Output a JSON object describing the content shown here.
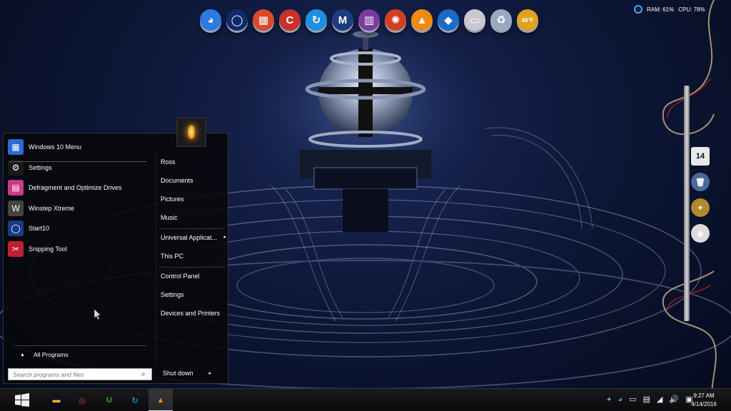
{
  "top_dock": {
    "icons": [
      {
        "name": "browser-globe-icon",
        "glyph": "◕",
        "color": "#2d7be0"
      },
      {
        "name": "start10-ring-icon",
        "glyph": "◯",
        "color": "#0e2a6a"
      },
      {
        "name": "file-manager-icon",
        "glyph": "▦",
        "color": "#d84a2a"
      },
      {
        "name": "ccleaner-icon",
        "glyph": "C",
        "color": "#c8302a"
      },
      {
        "name": "refresh-sync-icon",
        "glyph": "↻",
        "color": "#1d8fe0"
      },
      {
        "name": "malwarebytes-icon",
        "glyph": "M",
        "color": "#1a3d80"
      },
      {
        "name": "winrar-books-icon",
        "glyph": "▥",
        "color": "#7a3aa0"
      },
      {
        "name": "lamp-sun-icon",
        "glyph": "✺",
        "color": "#d04020"
      },
      {
        "name": "vlc-cone-icon",
        "glyph": "▲",
        "color": "#f08a10"
      },
      {
        "name": "teamviewer-diamond-icon",
        "glyph": "◆",
        "color": "#1a6ac8"
      },
      {
        "name": "drive-icon",
        "glyph": "▭",
        "color": "#c8c8cc"
      },
      {
        "name": "recycle-bin-icon",
        "glyph": "♻",
        "color": "#9aa8c0"
      },
      {
        "name": "weather-sun-icon",
        "glyph": "46°F",
        "color": "#e0a020"
      }
    ]
  },
  "system_meter": {
    "ram": "RAM: 61%",
    "cpu": "CPU: 78%"
  },
  "side_dock": {
    "icons": [
      {
        "name": "calendar-icon",
        "glyph": "14",
        "color": "#e8e8e8"
      },
      {
        "name": "recycle-bin-icon",
        "glyph": "🗑",
        "color": "#4a6a9a"
      },
      {
        "name": "winstep-gear-icon",
        "glyph": "✦",
        "color": "#b08a30"
      },
      {
        "name": "compass-icon",
        "glyph": "◉",
        "color": "#dcdcdc"
      }
    ]
  },
  "start_menu": {
    "programs": [
      {
        "label": "Windows 10 Menu",
        "icon": "windows-tiles-icon",
        "glyph": "▦",
        "color": "#2d6ad0"
      },
      {
        "label": "Settings",
        "icon": "gear-icon",
        "glyph": "⚙",
        "color": "#1a1a1a"
      },
      {
        "label": "Defragment and Optimize Drives",
        "icon": "defrag-icon",
        "glyph": "▤",
        "color": "#c83a8a"
      },
      {
        "label": "Winstep Xtreme",
        "icon": "winstep-icon",
        "glyph": "W",
        "color": "#444"
      },
      {
        "label": "Start10",
        "icon": "start10-icon",
        "glyph": "◯",
        "color": "#1a3a8a"
      },
      {
        "label": "Snipping Tool",
        "icon": "scissors-icon",
        "glyph": "✂",
        "color": "#c02030"
      }
    ],
    "all_programs": "All Programs",
    "search_placeholder": "Search programs and files",
    "places": [
      {
        "label": "Ross",
        "arrow": ""
      },
      {
        "label": "Documents",
        "arrow": ""
      },
      {
        "label": "Pictures",
        "arrow": ""
      },
      {
        "label": "Music",
        "arrow": ""
      },
      {
        "label": "Universal Applicat...",
        "arrow": "▸"
      },
      {
        "label": "This PC",
        "arrow": ""
      },
      {
        "label": "Control Panel",
        "arrow": ""
      },
      {
        "label": "Settings",
        "arrow": ""
      },
      {
        "label": "Devices and Printers",
        "arrow": ""
      }
    ],
    "shutdown_label": "Shut down",
    "shutdown_arrow": "▸"
  },
  "taskbar": {
    "pinned": [
      {
        "name": "file-explorer-icon",
        "glyph": "▬",
        "color": "#e8b840"
      },
      {
        "name": "chrome-icon",
        "glyph": "◎",
        "color": "#d03a2a"
      },
      {
        "name": "utorrent-icon",
        "glyph": "U",
        "color": "#3aa82a"
      },
      {
        "name": "ccleaner-refresh-icon",
        "glyph": "↻",
        "color": "#1d8fe0"
      },
      {
        "name": "vlc-icon",
        "glyph": "▲",
        "color": "#f08a10"
      }
    ],
    "tray": [
      {
        "name": "show-hidden-icon",
        "glyph": "+"
      },
      {
        "name": "sync-icon",
        "glyph": "◕"
      },
      {
        "name": "battery-icon",
        "glyph": "▭"
      },
      {
        "name": "card-icon",
        "glyph": "▤"
      },
      {
        "name": "wifi-icon",
        "glyph": "◢"
      },
      {
        "name": "volume-icon",
        "glyph": "🔊"
      },
      {
        "name": "notifications-icon",
        "glyph": "▣"
      }
    ],
    "time": "9:27 AM",
    "date": "4/14/2016"
  }
}
